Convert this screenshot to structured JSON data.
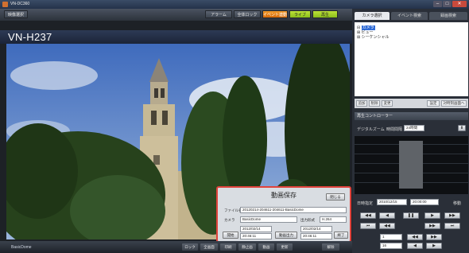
{
  "window": {
    "title": "VN-DC360",
    "close_glyph": "✕",
    "min_glyph": "–",
    "max_glyph": "□"
  },
  "toolbar": {
    "left_button": "映像選択",
    "buttons": [
      "アラーム",
      "全体ロック",
      "イベント連動",
      "ライブ",
      "再生"
    ]
  },
  "camera": {
    "name": "VN-H237"
  },
  "bottom": {
    "camera_label": "BasicDome",
    "buttons": [
      "ロック",
      "全画面",
      "印刷",
      "静止画",
      "動画",
      "更新",
      "解除"
    ]
  },
  "right_tabs": [
    "カメラ選択",
    "イベント検索",
    "録画検索"
  ],
  "tree": {
    "root": "カメラ",
    "children": [
      "ビュー",
      "シーケンシャル"
    ]
  },
  "tree_buttons": [
    "追加",
    "削除",
    "変更",
    "設定",
    "対時刻画面へ"
  ],
  "playback": {
    "header": "再生コントローラー",
    "digital_zoom": "デジタルズーム",
    "time_span_label": "時間間隔",
    "time_span": "24時間",
    "date_label": "日時指定",
    "date": "2010/12/15",
    "time": "20:00:00",
    "go": "移動",
    "speed": "1",
    "speed2": "16"
  },
  "dialog": {
    "title": "動画保存",
    "close": "閉じる",
    "file_label": "ファイル名",
    "file_value": "20120214-204611-204611-BasicDome",
    "camera_label": "カメラ",
    "camera_value": "BasicDome",
    "format_label": "出力形式",
    "format_value": "H.264",
    "start_button": "開始",
    "start_date": "2012/02/14",
    "start_time": "20:46:11",
    "export_button": "動画出力",
    "end_date": "2012/02/14",
    "end_time": "20:46:11",
    "end_button": "終了"
  }
}
